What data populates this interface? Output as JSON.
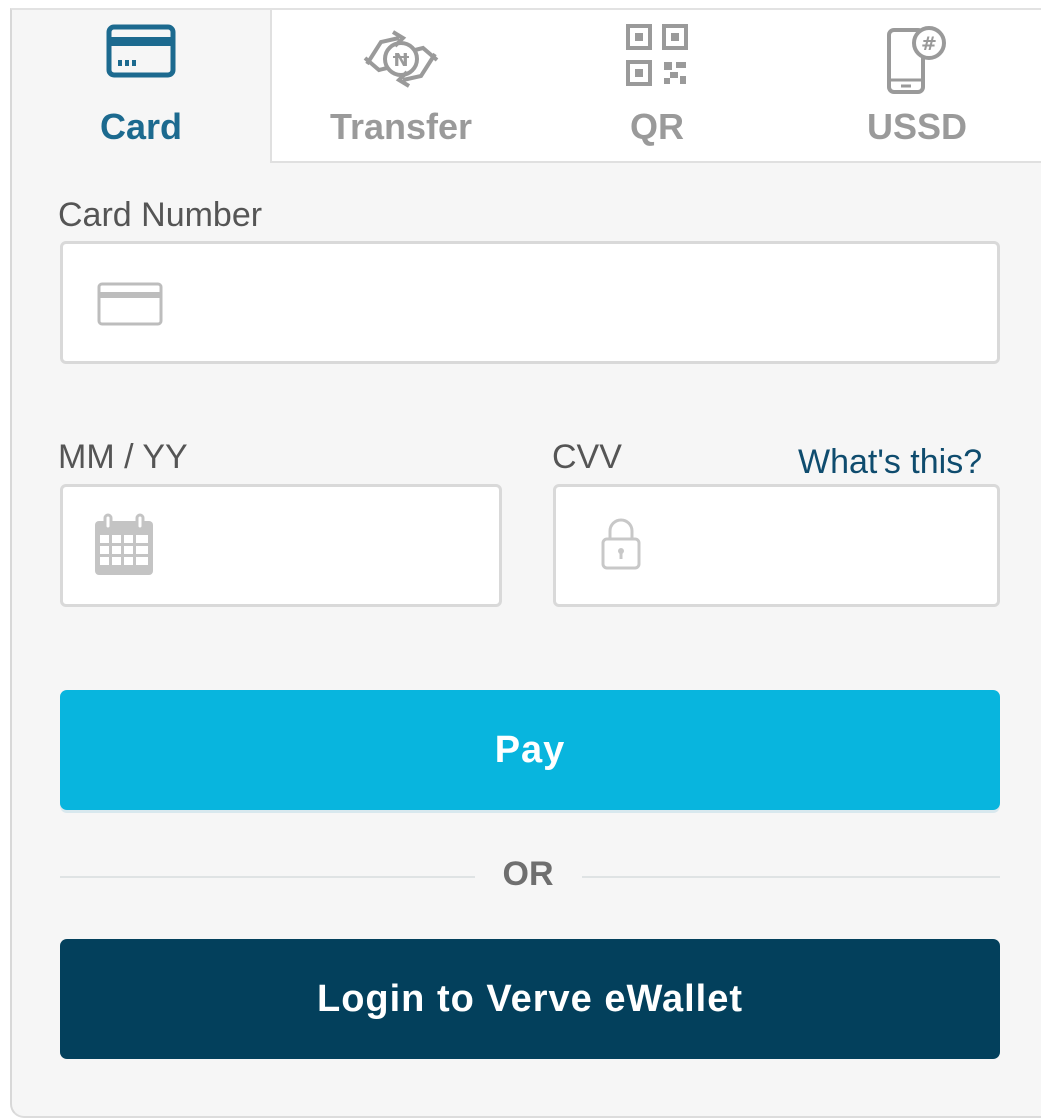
{
  "tabs": [
    {
      "label": "Card",
      "icon": "credit-card-icon",
      "active": true
    },
    {
      "label": "Transfer",
      "icon": "naira-transfer-icon",
      "active": false
    },
    {
      "label": "QR",
      "icon": "qr-code-icon",
      "active": false
    },
    {
      "label": "USSD",
      "icon": "phone-hash-icon",
      "active": false
    }
  ],
  "card_number": {
    "label": "Card Number",
    "value": "",
    "placeholder": "",
    "icon": "card-outline-icon"
  },
  "expiry": {
    "label": "MM / YY",
    "value": "",
    "placeholder": "",
    "icon": "calendar-icon"
  },
  "cvv": {
    "label": "CVV",
    "help_link": "What's this?",
    "value": "",
    "placeholder": "",
    "icon": "lock-icon"
  },
  "pay_button": {
    "label": "Pay"
  },
  "divider": {
    "label": "OR"
  },
  "login_button": {
    "label": "Login to Verve eWallet"
  },
  "colors": {
    "active_tab": "#1c6a8f",
    "inactive_tab": "#9a9a9a",
    "pay_button": "#08b5de",
    "login_button": "#03405c",
    "link": "#0f4c6e"
  }
}
